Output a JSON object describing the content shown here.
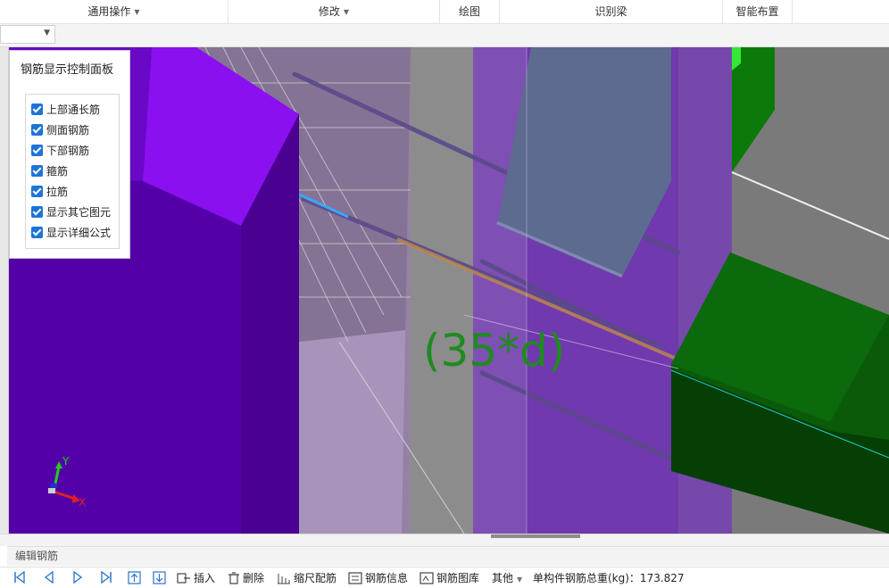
{
  "ribbon": {
    "groups": [
      {
        "label": "通用操作",
        "has_dropdown": true
      },
      {
        "label": "修改",
        "has_dropdown": true
      },
      {
        "label": "绘图",
        "has_dropdown": false
      },
      {
        "label": "识别梁",
        "has_dropdown": false
      },
      {
        "label": "智能布置",
        "has_dropdown": false
      }
    ]
  },
  "combo": {
    "value": ""
  },
  "viewport": {
    "dimension_label": "(35*d)",
    "axis": {
      "y": "Y",
      "x": "X"
    },
    "colors": {
      "column": "#5a0fb0",
      "beam_green": "#0a5a0a",
      "highlight_green": "#1f8a1f",
      "grey_beam": "#5f6b8f"
    }
  },
  "panel": {
    "title": "钢筋显示控制面板",
    "options": [
      {
        "label": "上部通长筋",
        "checked": true
      },
      {
        "label": "侧面钢筋",
        "checked": true
      },
      {
        "label": "下部钢筋",
        "checked": true
      },
      {
        "label": "箍筋",
        "checked": true
      },
      {
        "label": "拉筋",
        "checked": true
      },
      {
        "label": "显示其它图元",
        "checked": true
      },
      {
        "label": "显示详细公式",
        "checked": true
      }
    ]
  },
  "bottom": {
    "section_label": "编辑钢筋",
    "tools": {
      "insert": "插入",
      "delete": "删除",
      "scale": "缩尺配筋",
      "info": "钢筋信息",
      "library": "钢筋图库",
      "other": "其他",
      "total": "单构件钢筋总重(kg)：173.827"
    }
  }
}
